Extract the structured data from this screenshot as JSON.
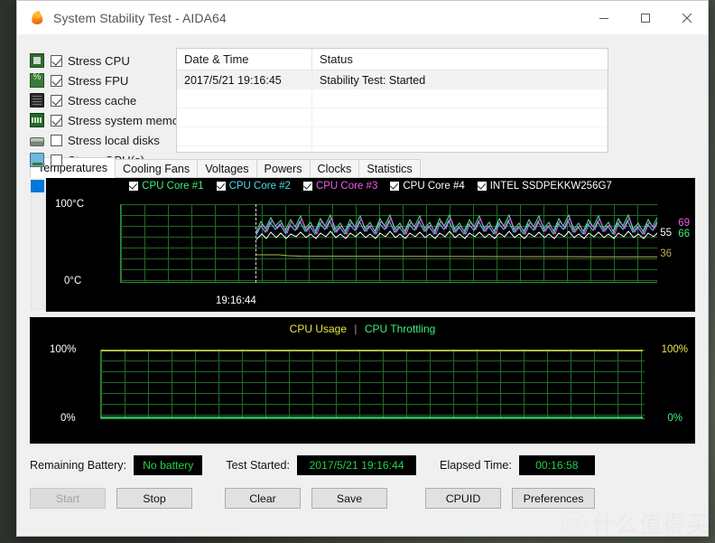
{
  "window": {
    "title": "System Stability Test - AIDA64",
    "icon": "flame-icon",
    "minimize": "—",
    "maximize": "□",
    "close": "✕"
  },
  "stress_options": [
    {
      "label": "Stress CPU",
      "checked": true,
      "icon": "cpu-icon"
    },
    {
      "label": "Stress FPU",
      "checked": true,
      "icon": "fpu-icon"
    },
    {
      "label": "Stress cache",
      "checked": true,
      "icon": "cache-icon"
    },
    {
      "label": "Stress system memory",
      "checked": true,
      "icon": "memory-icon"
    },
    {
      "label": "Stress local disks",
      "checked": false,
      "icon": "disk-icon"
    },
    {
      "label": "Stress GPU(s)",
      "checked": false,
      "icon": "gpu-icon"
    }
  ],
  "log": {
    "columns": [
      "Date & Time",
      "Status"
    ],
    "rows": [
      {
        "datetime": "2017/5/21 19:16:45",
        "status": "Stability Test: Started"
      }
    ],
    "empty_rows": 4
  },
  "tabs": [
    {
      "label": "Temperatures",
      "active": true
    },
    {
      "label": "Cooling Fans",
      "active": false
    },
    {
      "label": "Voltages",
      "active": false
    },
    {
      "label": "Powers",
      "active": false
    },
    {
      "label": "Clocks",
      "active": false
    },
    {
      "label": "Statistics",
      "active": false
    }
  ],
  "status_bar": {
    "battery_label": "Remaining Battery:",
    "battery_value": "No battery",
    "started_label": "Test Started:",
    "started_value": "2017/5/21 19:16:44",
    "elapsed_label": "Elapsed Time:",
    "elapsed_value": "00:16:58"
  },
  "buttons": {
    "start": "Start",
    "stop": "Stop",
    "clear": "Clear",
    "save": "Save",
    "cpuid": "CPUID",
    "preferences": "Preferences"
  },
  "watermark": {
    "logo": "值",
    "text": "什么值得买"
  },
  "colors": {
    "core1": "#3ef07a",
    "core2": "#4fd8f5",
    "core3": "#f05cf0",
    "core4": "#ffffff",
    "ssd": "#b8b05a",
    "grid": "#1d6b28",
    "axis": "#2e8b3a",
    "usage": "#e8e84a",
    "throttle": "#3ef07a",
    "value_green": "#22d24a"
  },
  "chart_data": [
    {
      "type": "line",
      "title": "Temperatures",
      "ylabel": "100°C",
      "ylabel_bottom": "0°C",
      "ylim": [
        0,
        100
      ],
      "xlabel": "19:16:44",
      "grid": true,
      "legend_position": "top-center",
      "legend": [
        {
          "label": "CPU Core #1",
          "color": "#3ef07a",
          "checked": true
        },
        {
          "label": "CPU Core #2",
          "color": "#4fd8f5",
          "checked": true
        },
        {
          "label": "CPU Core #3",
          "color": "#f05cf0",
          "checked": true
        },
        {
          "label": "CPU Core #4",
          "color": "#ffffff",
          "checked": true
        },
        {
          "label": "INTEL SSDPEKKW256G7",
          "color": "#ffffff",
          "checked": true
        }
      ],
      "current_values": [
        {
          "label": "69",
          "color": "#f05cf0"
        },
        {
          "label": "66",
          "color": "#3ef07a"
        },
        {
          "label": "55",
          "color": "#ffffff"
        },
        {
          "label": "36",
          "color": "#b8b05a"
        }
      ],
      "series": [
        {
          "name": "CPU Core #1",
          "color": "#3ef07a",
          "mean": 66,
          "min": 58,
          "max": 76
        },
        {
          "name": "CPU Core #2",
          "color": "#4fd8f5",
          "mean": 64,
          "min": 56,
          "max": 74
        },
        {
          "name": "CPU Core #3",
          "color": "#f05cf0",
          "mean": 69,
          "min": 60,
          "max": 78
        },
        {
          "name": "CPU Core #4",
          "color": "#ffffff",
          "mean": 55,
          "min": 48,
          "max": 64
        },
        {
          "name": "INTEL SSDPEKKW256G7",
          "color": "#b8b05a",
          "mean": 36,
          "min": 35,
          "max": 38
        }
      ]
    },
    {
      "type": "line",
      "title": "CPU Usage  |  CPU Throttling",
      "legend": [
        {
          "label": "CPU Usage",
          "color": "#e8e84a"
        },
        {
          "label": "CPU Throttling",
          "color": "#3ef07a"
        }
      ],
      "ylabel": "100%",
      "ylabel_bottom": "0%",
      "ylabel_right": "100%",
      "ylabel_right_bottom": "0%",
      "ylim": [
        0,
        100
      ],
      "grid": true,
      "series": [
        {
          "name": "CPU Usage",
          "color": "#e8e84a",
          "value": 100
        },
        {
          "name": "CPU Throttling",
          "color": "#3ef07a",
          "value": 0
        }
      ]
    }
  ]
}
